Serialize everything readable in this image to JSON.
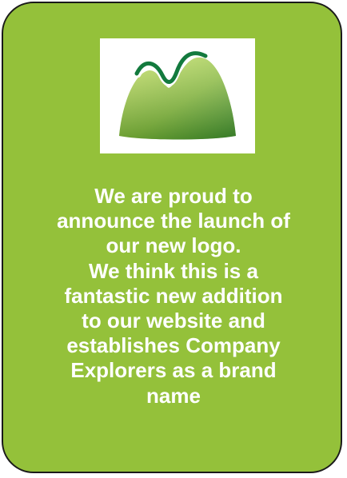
{
  "colors": {
    "card_background": "#94c13a",
    "card_border": "#1a1a1a",
    "text": "#ffffff",
    "logo_mountain_light": "#b5d64c",
    "logo_mountain_dark": "#3f8a2c",
    "logo_swoosh": "#137a3e"
  },
  "logo": {
    "icon": "green-mountain-logo-icon"
  },
  "announcement": {
    "lines": [
      "We are proud to",
      "announce the launch of",
      "our new logo.",
      "We think this is a",
      "fantastic new addition",
      "to our website and",
      "establishes Company",
      "Explorers as a brand",
      "name"
    ]
  }
}
